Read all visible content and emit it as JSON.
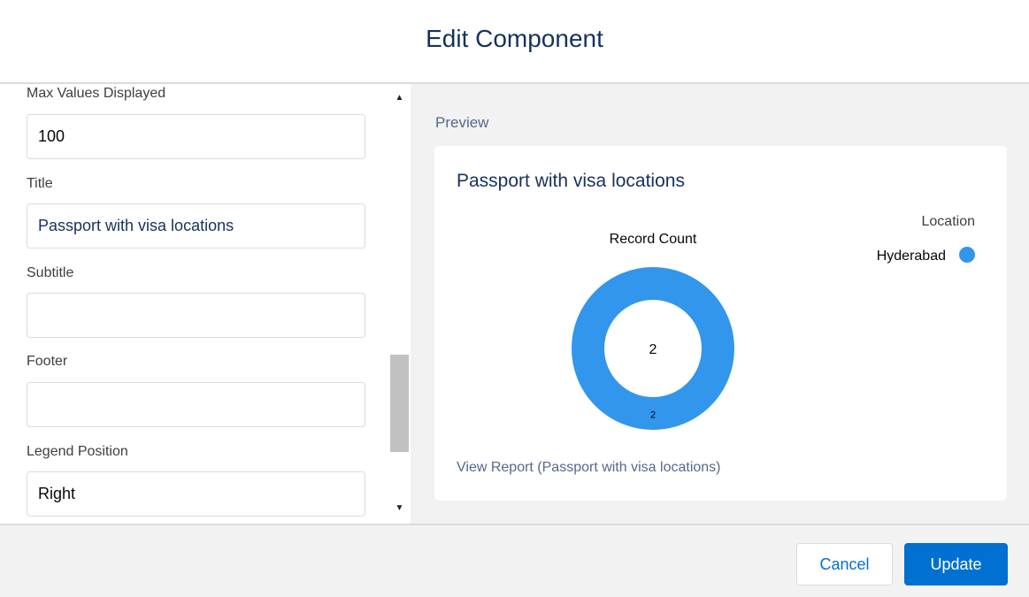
{
  "modal": {
    "title": "Edit Component"
  },
  "form": {
    "max_values_label": "Max Values Displayed",
    "max_values_value": "100",
    "title_label": "Title",
    "title_value": "Passport with visa locations",
    "subtitle_label": "Subtitle",
    "subtitle_value": "",
    "footer_label": "Footer",
    "footer_value": "",
    "legend_position_label": "Legend Position",
    "legend_position_value": "Right"
  },
  "preview": {
    "label": "Preview",
    "card_title": "Passport with visa locations",
    "view_report": "View Report (Passport with visa locations)"
  },
  "chart_data": {
    "type": "donut",
    "title": "Record Count",
    "center_total": "2",
    "legend_title": "Location",
    "legend_position": "right",
    "series": [
      {
        "name": "Hyderabad",
        "value": 2,
        "label": "2",
        "color": "#3296ed"
      }
    ]
  },
  "footer": {
    "cancel_label": "Cancel",
    "update_label": "Update"
  },
  "colors": {
    "brand": "#0070d2",
    "chart_series": "#3296ed",
    "preview_bg": "#f3f2f2"
  },
  "icons": {
    "scroll_up": "triangle-up-icon",
    "scroll_down": "triangle-down-icon",
    "legend_marker": "circle-icon"
  }
}
